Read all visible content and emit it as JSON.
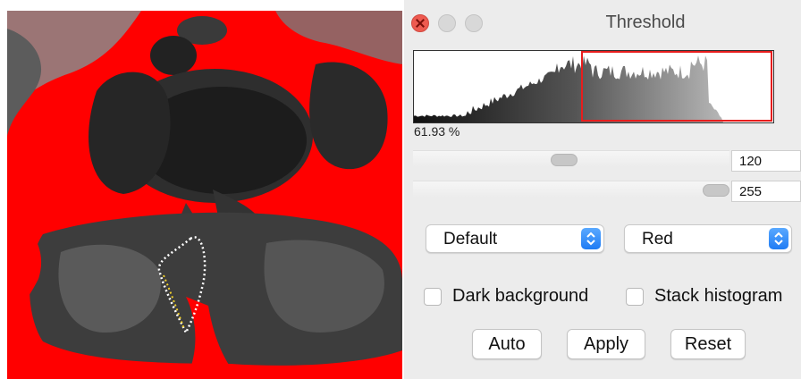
{
  "window": {
    "title": "Threshold"
  },
  "histogram": {
    "percent_label": "61.93 %",
    "selection_color": "#e81d1d"
  },
  "sliders": {
    "lower": {
      "value": "120"
    },
    "upper": {
      "value": "255"
    }
  },
  "method_select": {
    "value": "Default"
  },
  "display_select": {
    "value": "Red"
  },
  "options": {
    "dark_background": {
      "label": "Dark background",
      "checked": false
    },
    "stack_histogram": {
      "label": "Stack histogram",
      "checked": false
    }
  },
  "buttons": {
    "auto": "Auto",
    "apply": "Apply",
    "reset": "Reset"
  },
  "colors": {
    "overlay": "#ff0000",
    "select_accent": "#1f7cf4"
  }
}
